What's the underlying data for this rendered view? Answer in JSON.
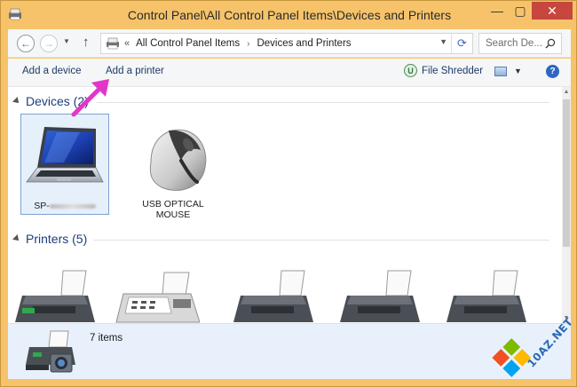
{
  "window": {
    "title": "Control Panel\\All Control Panel Items\\Devices and Printers",
    "minimize_glyph": "—",
    "maximize_glyph": "▢",
    "close_glyph": "✕"
  },
  "address": {
    "breadcrumbs": [
      "All Control Panel Items",
      "Devices and Printers"
    ],
    "overflow_glyph": "«",
    "search_placeholder": "Search De..."
  },
  "toolbar": {
    "add_device": "Add a device",
    "add_printer": "Add a printer",
    "file_shredder": "File Shredder"
  },
  "groups": {
    "devices": {
      "label": "Devices (2)"
    },
    "printers": {
      "label": "Printers (5)"
    }
  },
  "devices": [
    {
      "name_prefix": "SP-",
      "icon": "laptop-icon",
      "selected": true
    },
    {
      "name": "USB OPTICAL MOUSE",
      "icon": "mouse-icon",
      "selected": false
    }
  ],
  "printers": [
    {
      "icon": "printer-icon"
    },
    {
      "icon": "fax-icon"
    },
    {
      "icon": "printer-icon"
    },
    {
      "icon": "printer-icon"
    },
    {
      "icon": "printer-icon"
    }
  ],
  "details": {
    "item_count": "7 items"
  },
  "watermark": {
    "text": "10AZ.NET"
  },
  "colors": {
    "frame": "#f6c36a",
    "group_label": "#1e3e7b",
    "command_text": "#1e3a66",
    "annotation_arrow": "#e236c9",
    "close_button": "#c7463e"
  }
}
